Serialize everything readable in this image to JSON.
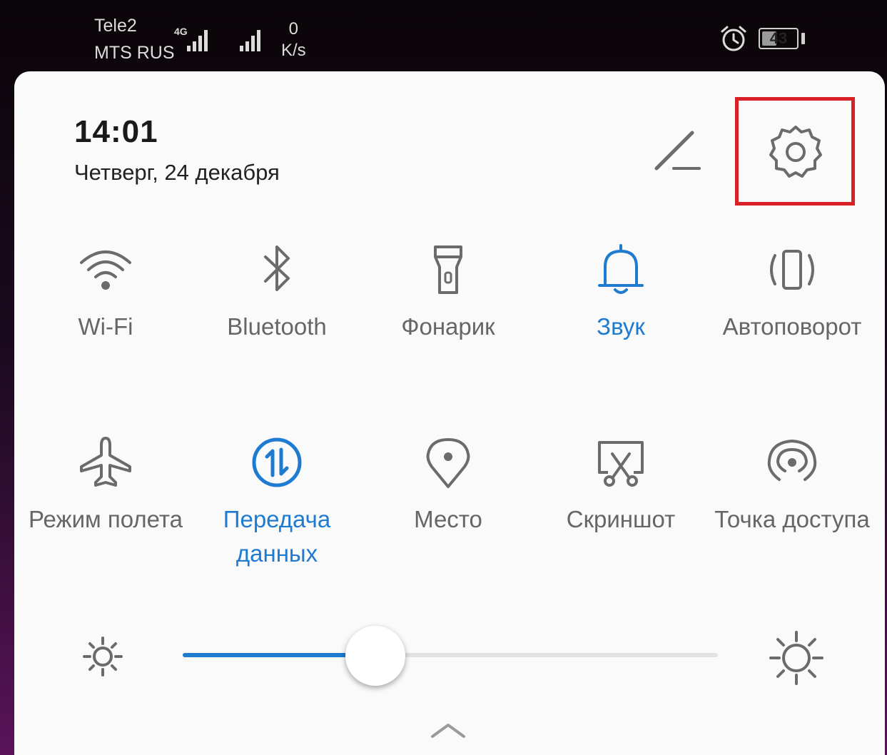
{
  "status_bar": {
    "carrier1": "Tele2",
    "carrier2": "MTS RUS",
    "network_type": "4G",
    "speed_value": "0",
    "speed_unit": "K/s",
    "battery_level": "43",
    "battery_fraction": 0.43
  },
  "header": {
    "time": "14:01",
    "date": "Четверг, 24 декабря"
  },
  "tiles": [
    {
      "label": "Wi-Fi",
      "icon": "wifi-icon",
      "active": false
    },
    {
      "label": "Bluetooth",
      "icon": "bluetooth-icon",
      "active": false
    },
    {
      "label": "Фонарик",
      "icon": "flashlight-icon",
      "active": false
    },
    {
      "label": "Звук",
      "icon": "bell-icon",
      "active": true
    },
    {
      "label": "Автоповорот",
      "icon": "auto-rotate-icon",
      "active": false
    },
    {
      "label": "Режим полета",
      "icon": "airplane-icon",
      "active": false
    },
    {
      "label": "Передача данных",
      "icon": "mobile-data-icon",
      "active": true
    },
    {
      "label": "Место",
      "icon": "location-icon",
      "active": false
    },
    {
      "label": "Скриншот",
      "icon": "screenshot-icon",
      "active": false
    },
    {
      "label": "Точка доступа",
      "icon": "hotspot-icon",
      "active": false
    }
  ],
  "brightness": {
    "level": 0.36
  },
  "colors": {
    "accent": "#1e7bd0",
    "highlight": "#d92027",
    "icon_inactive": "#6b6b6b",
    "panel": "#fafafa"
  }
}
